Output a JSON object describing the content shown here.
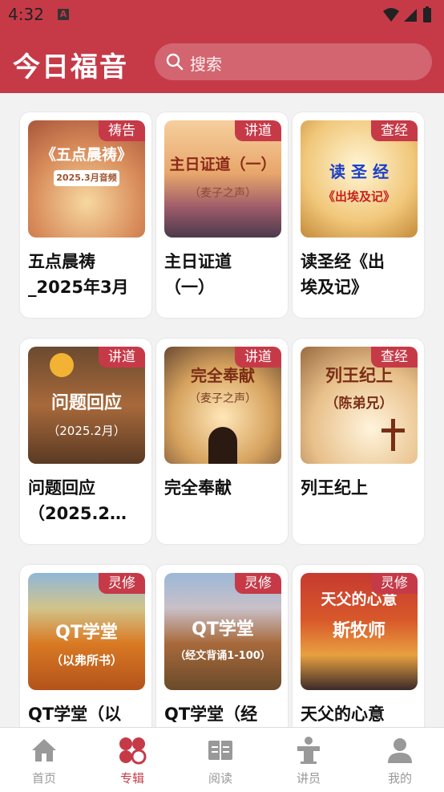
{
  "status_bar": {
    "time": "4:32"
  },
  "header": {
    "title": "今日福音",
    "search_placeholder": "搜索"
  },
  "cards": [
    {
      "tag": "祷告",
      "title": "五点晨祷\n_2025年3月",
      "art_line1": "《五点晨祷》",
      "art_line2": "2025.3月音频"
    },
    {
      "tag": "讲道",
      "title": "主日证道\n（一）",
      "art_line1": "主日证道（一）",
      "art_line2": "（麦子之声）"
    },
    {
      "tag": "查经",
      "title": "读圣经《出\n埃及记》",
      "art_line1": "读 圣 经",
      "art_line2": "《出埃及记》"
    },
    {
      "tag": "讲道",
      "title": "问题回应\n（2025.2…",
      "art_line1": "问题回应",
      "art_line2": "（2025.2月）"
    },
    {
      "tag": "讲道",
      "title": "完全奉献",
      "art_line1": "完全奉献",
      "art_line2": "（麦子之声）"
    },
    {
      "tag": "查经",
      "title": "列王纪上",
      "art_line1": "列王纪上",
      "art_line2": "（陈弟兄）"
    },
    {
      "tag": "灵修",
      "title": "QT学堂（以",
      "art_line1": "QT学堂",
      "art_line2": "（以弗所书）"
    },
    {
      "tag": "灵修",
      "title": "QT学堂（经",
      "art_line1": "QT学堂",
      "art_line2": "（经文背诵1-100）"
    },
    {
      "tag": "灵修",
      "title": "天父的心意",
      "art_line1": "天父的心意",
      "art_line2": "斯牧师"
    }
  ],
  "tabs": [
    {
      "label": "首页",
      "icon": "home-icon"
    },
    {
      "label": "专辑",
      "icon": "album-icon"
    },
    {
      "label": "阅读",
      "icon": "book-icon"
    },
    {
      "label": "讲员",
      "icon": "speaker-icon"
    },
    {
      "label": "我的",
      "icon": "user-icon"
    }
  ],
  "colors": {
    "primary": "#c63a48",
    "inactive": "#999999"
  }
}
